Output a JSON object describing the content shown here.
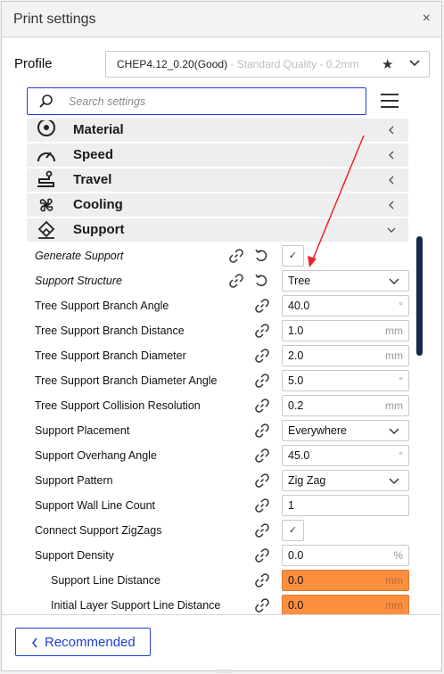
{
  "window": {
    "title": "Print settings",
    "close_symbol": "×"
  },
  "profile": {
    "label": "Profile",
    "name": "CHEP4.12_0.20(Good)",
    "sub": " - Standard Quality - 0.2mm",
    "star_symbol": "★"
  },
  "search": {
    "placeholder": "Search settings"
  },
  "categories": [
    {
      "label": "Material",
      "icon": "material-icon",
      "state": "collapsed"
    },
    {
      "label": "Speed",
      "icon": "speed-icon",
      "state": "collapsed"
    },
    {
      "label": "Travel",
      "icon": "travel-icon",
      "state": "collapsed"
    },
    {
      "label": "Cooling",
      "icon": "cooling-icon",
      "state": "collapsed"
    },
    {
      "label": "Support",
      "icon": "support-icon",
      "state": "expanded"
    }
  ],
  "settings": [
    {
      "label": "Generate Support",
      "type": "checkbox",
      "checked": true,
      "value": "✓"
    },
    {
      "label": "Support Structure",
      "type": "select",
      "value": "Tree"
    },
    {
      "label": "Tree Support Branch Angle",
      "type": "number",
      "value": "40.0",
      "unit": "°"
    },
    {
      "label": "Tree Support Branch Distance",
      "type": "number",
      "value": "1.0",
      "unit": "mm"
    },
    {
      "label": "Tree Support Branch Diameter",
      "type": "number",
      "value": "2.0",
      "unit": "mm"
    },
    {
      "label": "Tree Support Branch Diameter Angle",
      "type": "number",
      "value": "5.0",
      "unit": "°"
    },
    {
      "label": "Tree Support Collision Resolution",
      "type": "number",
      "value": "0.2",
      "unit": "mm"
    },
    {
      "label": "Support Placement",
      "type": "select",
      "value": "Everywhere"
    },
    {
      "label": "Support Overhang Angle",
      "type": "number",
      "value": "45.0",
      "unit": "°"
    },
    {
      "label": "Support Pattern",
      "type": "select",
      "value": "Zig Zag"
    },
    {
      "label": "Support Wall Line Count",
      "type": "number",
      "value": "1",
      "unit": ""
    },
    {
      "label": "Connect Support ZigZags",
      "type": "checkbox",
      "checked": true,
      "value": "✓"
    },
    {
      "label": "Support Density",
      "type": "number",
      "value": "0.0",
      "unit": "%"
    },
    {
      "label": "Support Line Distance",
      "type": "number",
      "value": "0.0",
      "unit": "mm",
      "highlight": "#fd8f3f"
    },
    {
      "label": "Initial Layer Support Line Distance",
      "type": "number",
      "value": "0.0",
      "unit": "mm",
      "highlight": "#fd8f3f"
    }
  ],
  "footer": {
    "recommended_label": "Recommended"
  },
  "colors": {
    "accent": "#1f3fd1",
    "warning": "#fd8f3f",
    "scrollbar": "#17274d",
    "annotation_arrow": "#e8262b"
  }
}
